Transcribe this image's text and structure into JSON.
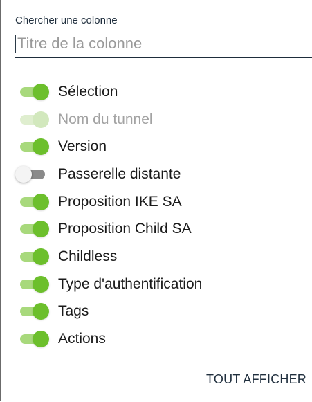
{
  "search": {
    "label": "Chercher une colonne",
    "placeholder": "Titre de la colonne",
    "value": ""
  },
  "columns": [
    {
      "label": "Sélection",
      "checked": true,
      "disabled": false
    },
    {
      "label": "Nom du tunnel",
      "checked": true,
      "disabled": true
    },
    {
      "label": "Version",
      "checked": true,
      "disabled": false
    },
    {
      "label": "Passerelle distante",
      "checked": false,
      "disabled": false
    },
    {
      "label": "Proposition IKE SA",
      "checked": true,
      "disabled": false
    },
    {
      "label": "Proposition Child SA",
      "checked": true,
      "disabled": false
    },
    {
      "label": "Childless",
      "checked": true,
      "disabled": false
    },
    {
      "label": "Type d'authentification",
      "checked": true,
      "disabled": false
    },
    {
      "label": "Tags",
      "checked": true,
      "disabled": false
    },
    {
      "label": "Actions",
      "checked": true,
      "disabled": false
    }
  ],
  "footer": {
    "show_all_label": "TOUT AFFICHER"
  },
  "colors": {
    "toggle_on_thumb": "#6cbf2c",
    "toggle_on_track": "#a8d97c",
    "toggle_off_thumb": "#f4f4f4",
    "toggle_off_track": "#8a8a8a",
    "input_underline": "#1e2d3b"
  }
}
